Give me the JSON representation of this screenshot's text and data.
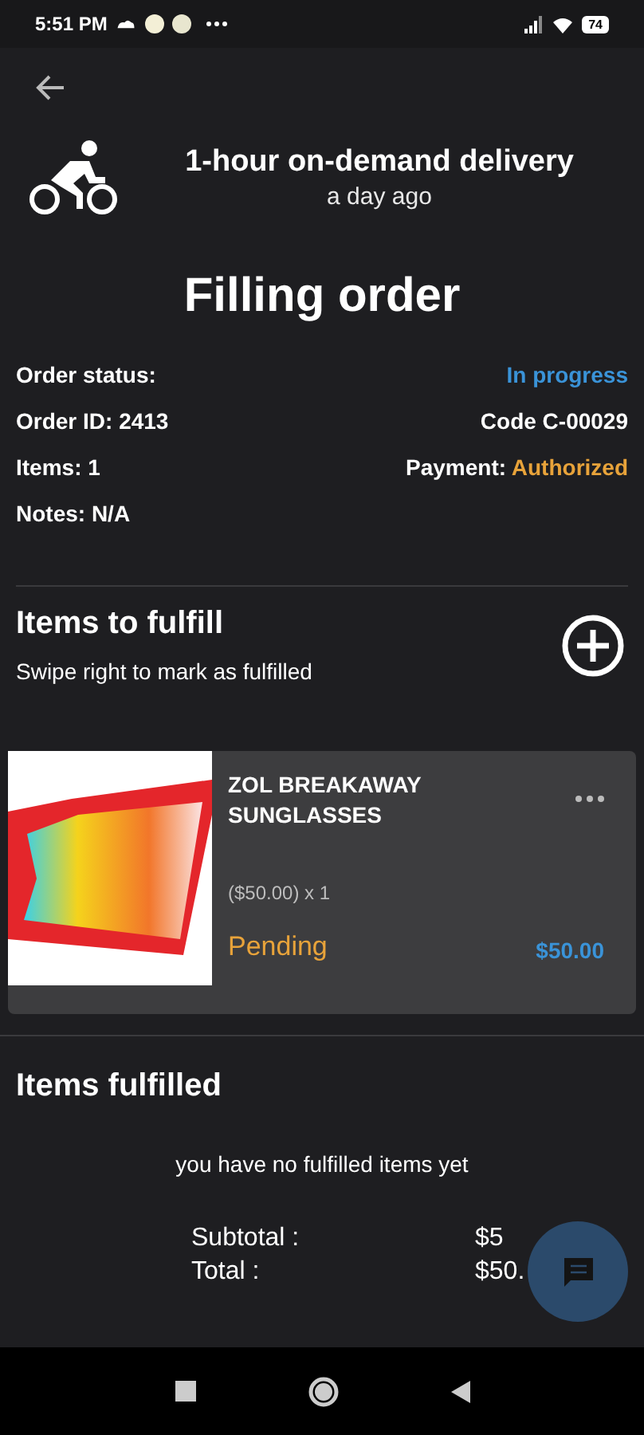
{
  "status_bar": {
    "time": "5:51 PM",
    "battery": "74"
  },
  "header": {
    "title": "1-hour on-demand delivery",
    "subtitle": "a day ago"
  },
  "heading": "Filling order",
  "info_rows": [
    {
      "left": "Order status:",
      "right": {
        "kind": "status",
        "value": "In progress"
      }
    },
    {
      "left": "Order ID: 2413",
      "right": {
        "kind": "plain",
        "value": "Code C-00029"
      }
    },
    {
      "left": "Items: 1",
      "right": {
        "kind": "payment",
        "label": "Payment:",
        "value": "Authorized"
      }
    },
    {
      "left": "Notes: N/A"
    }
  ],
  "to_fulfill": {
    "title": "Items to fulfill",
    "hint": "Swipe right to mark as fulfilled",
    "items": [
      {
        "name": "ZOL BREAKAWAY SUNGLASSES",
        "unit_price": "($50.00) x 1",
        "status": "Pending",
        "price": "$50.00"
      }
    ]
  },
  "fulfilled": {
    "title": "Items fulfilled",
    "empty_message": "you have no fulfilled items yet"
  },
  "totals": [
    {
      "label": "Subtotal :",
      "value": "$5"
    },
    {
      "label": "Total :",
      "value": "$50."
    }
  ]
}
